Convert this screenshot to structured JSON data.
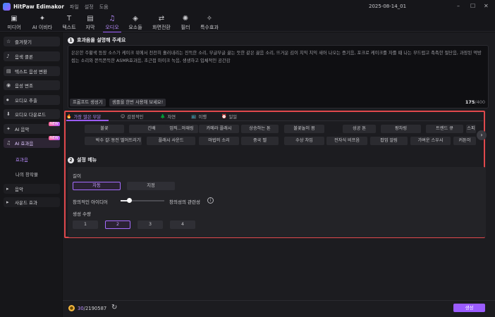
{
  "app": {
    "name": "HitPaw Edimakor",
    "menu": [
      "파일",
      "설정",
      "도움"
    ],
    "date": "2025-08-14_01"
  },
  "toolbar": [
    {
      "icon": "media-icon",
      "glyph": "▣",
      "label": "미디어"
    },
    {
      "icon": "ai-icon",
      "glyph": "✦",
      "label": "AI 이비타"
    },
    {
      "icon": "text-icon",
      "glyph": "T",
      "label": "텍스트"
    },
    {
      "icon": "caption-icon",
      "glyph": "▤",
      "label": "자막"
    },
    {
      "icon": "audio-icon",
      "glyph": "♫",
      "label": "오디오"
    },
    {
      "icon": "elements-icon",
      "glyph": "◈",
      "label": "요소들"
    },
    {
      "icon": "transition-icon",
      "glyph": "⇄",
      "label": "화면전환"
    },
    {
      "icon": "filter-icon",
      "glyph": "✺",
      "label": "필터"
    },
    {
      "icon": "effects-icon",
      "glyph": "✧",
      "label": "특수효과"
    }
  ],
  "sidebar": {
    "items": [
      {
        "glyph": "☆",
        "label": "즐겨찾기"
      },
      {
        "glyph": "♪",
        "label": "음색 클론"
      },
      {
        "glyph": "▤",
        "label": "텍스트 음성 변환"
      },
      {
        "glyph": "◉",
        "label": "음성 변조"
      },
      {
        "glyph": "⏺",
        "label": "오디오 추출"
      },
      {
        "glyph": "⬇",
        "label": "오디오 다운로드"
      },
      {
        "glyph": "✦",
        "label": "AI 음악"
      },
      {
        "glyph": "♫",
        "label": "AI 효과음"
      }
    ],
    "subitems": [
      "효과음",
      "나의 창작물"
    ],
    "more": [
      {
        "glyph": "▸",
        "label": "음악"
      },
      {
        "glyph": "▸",
        "label": "사운드 효과"
      }
    ],
    "badge": "NEW"
  },
  "prompt": {
    "section_num": "1",
    "title": "효과음을 설명해 주세요",
    "text": "은은한 주황색 등장 소스가 케이크 위에서 천천히 흘러내리는 진득한 소리, 부글부글 끓는 듯한 같은 끓음 소리, 뜨거운 김이 치익 치익 새어 나오는 증기음, 포크로 케이크를 자를 때 나는 부드럽고 촉촉한 절단음, 과장된 먹방 씹는 소리와 쫀득쫀득한 ASMR효과음, 초근접 마이크 녹음, 생생하고 입체적인 공간감",
    "generate_label": "프롬프트 생성기",
    "try_label": "샘플을 한번 사용해 보세요!",
    "count_current": "175",
    "count_max": "/400"
  },
  "tabs": [
    {
      "emoji": "🔥",
      "label": "가장 많은 부분"
    },
    {
      "emoji": "😊",
      "label": "감정적인"
    },
    {
      "emoji": "🌲",
      "label": "자연"
    },
    {
      "emoji": "📺",
      "label": "이행"
    },
    {
      "emoji": "⏰",
      "label": "일일"
    }
  ],
  "chips": [
    [
      "불꽃",
      "긴배",
      "업직...아재링",
      "카메라 플래시",
      "상승하는 톤",
      "불꽃놀이 몸",
      "성공 톤",
      "팡차링",
      "트렌드 큐",
      "스피"
    ],
    [
      "박수 갈채",
      "동전 떨어뜨리기",
      "플래시 사운드",
      "마법의 소리",
      "중국 벨",
      "수상 차임",
      "전자식 비프음",
      "팝업 알림",
      "가벼운 스우시",
      "커튼이"
    ]
  ],
  "settings": {
    "section_num": "2",
    "title": "설정 메뉴",
    "length_label": "길이",
    "length_options": [
      "자동",
      "지정"
    ],
    "creative_label": "창의적인 아이디어",
    "relevance_label": "창의성의 관련성",
    "creative_value": 0.2,
    "count_label": "생성 수량",
    "count_options": [
      "1",
      "2",
      "3",
      "4"
    ],
    "selected_count": "2"
  },
  "footer": {
    "credits_used": "30",
    "credits_total": "/2190587",
    "generate_label": "생성"
  }
}
